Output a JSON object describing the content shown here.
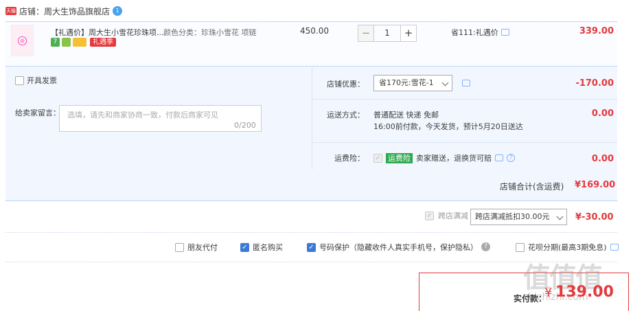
{
  "shop": {
    "badge": "天猫",
    "label": "店铺：周大生饰品旗舰店",
    "ww_icon": "1"
  },
  "item": {
    "title": "【礼遇价】周大生小雪花珍珠项...",
    "spec": "颜色分类：珍珠小雪花 项链",
    "service_7": "7",
    "promo_tag": "礼遇季",
    "unit_price": "450.00",
    "qty_minus": "−",
    "qty": "1",
    "qty_plus": "+",
    "discount_note": "省111:礼遇价",
    "total": "339.00"
  },
  "invoice": {
    "label": "开具发票"
  },
  "message": {
    "label": "给卖家留言：",
    "placeholder": "选填，请先和商家协商一致，付款后商家可见",
    "count": "0/200"
  },
  "shop_discount": {
    "label": "店铺优惠：",
    "selected": "省170元:雪花-1",
    "amount": "-170.00"
  },
  "shipping": {
    "label": "运送方式：",
    "line1": "普通配送 快递 免邮",
    "line2": "16:00前付款，今天发货，预计5月20日送达",
    "amount": "0.00"
  },
  "insurance": {
    "label": "运费险：",
    "tag": "运费险",
    "desc": "卖家赠送，退换货可赔",
    "amount": "0.00"
  },
  "subtotal": {
    "label": "店铺合计(含运费)",
    "value": "¥169.00"
  },
  "cross_store": {
    "label": "跨店满减",
    "selected": "跨店满减抵扣30.00元",
    "amount": "¥-30.00"
  },
  "options": {
    "friend_pay": "朋友代付",
    "anonymous": "匿名购买",
    "number_protect": "号码保护（隐藏收件人真实手机号，保护隐私）",
    "huabei": "花呗分期(最高3期免息)"
  },
  "payment": {
    "label": "实付款：",
    "currency": "¥",
    "value": "139.00"
  },
  "watermark": {
    "main": "值值值",
    "sub": "zhizhizhi.com"
  },
  "colors": {
    "accent_red": "#e4393c",
    "panel_bg": "#f2f7ff",
    "check_blue": "#3a7bd5"
  }
}
